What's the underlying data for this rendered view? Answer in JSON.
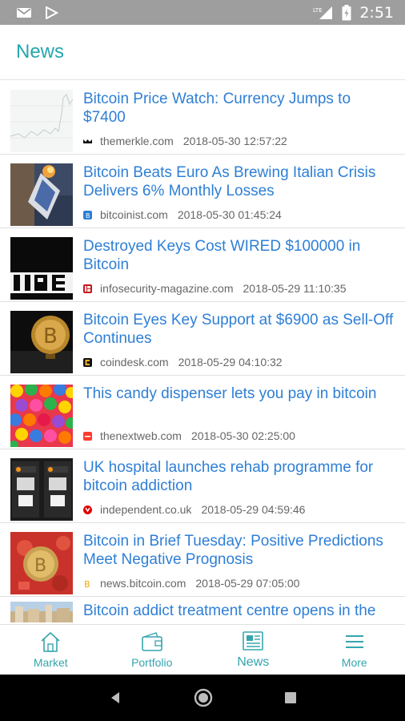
{
  "status_bar": {
    "time": "2:51",
    "network": "LTE",
    "icons": [
      "gmail-icon",
      "play-store-icon",
      "lte-signal-icon",
      "battery-icon"
    ]
  },
  "app_bar": {
    "title": "News"
  },
  "colors": {
    "accent": "#26a6b0",
    "headline": "#2e7fd6"
  },
  "news": [
    {
      "headline": "Bitcoin Price Watch: Currency Jumps to $7400",
      "source": "themerkle.com",
      "timestamp": "2018-05-30 12:57:22",
      "source_icon": "themerkle-icon",
      "thumbnail": "price-chart-thumbnail"
    },
    {
      "headline": "Bitcoin Beats Euro As Brewing Italian Crisis Delivers 6% Monthly Losses",
      "source": "bitcoinist.com",
      "timestamp": "2018-05-30 01:45:24",
      "source_icon": "bitcoinist-icon",
      "thumbnail": "burning-bitcoin-thumbnail"
    },
    {
      "headline": "Destroyed Keys Cost WIRED $100000 in Bitcoin",
      "source": "infosecurity-magazine.com",
      "timestamp": "2018-05-29 11:10:35",
      "source_icon": "infosecurity-icon",
      "thumbnail": "wired-logo-thumbnail"
    },
    {
      "headline": "Bitcoin Eyes Key Support at $6900 as Sell-Off Continues",
      "source": "coindesk.com",
      "timestamp": "2018-05-29 04:10:32",
      "source_icon": "coindesk-icon",
      "thumbnail": "gold-coin-thumbnail"
    },
    {
      "headline": "This candy dispenser lets you pay in bitcoin",
      "source": "thenextweb.com",
      "timestamp": "2018-05-30 02:25:00",
      "source_icon": "thenextweb-icon",
      "thumbnail": "candy-thumbnail"
    },
    {
      "headline": "UK hospital launches rehab programme for bitcoin addiction",
      "source": "independent.co.uk",
      "timestamp": "2018-05-29 04:59:46",
      "source_icon": "independent-icon",
      "thumbnail": "bitcoin-atm-thumbnail"
    },
    {
      "headline": "Bitcoin in Brief Tuesday: Positive Predictions Meet Negative Prognosis",
      "source": "news.bitcoin.com",
      "timestamp": "2018-05-29 07:05:00",
      "source_icon": "bitcoin-news-icon",
      "thumbnail": "red-coin-thumbnail"
    },
    {
      "headline": "Bitcoin addict treatment centre opens in the",
      "source": "",
      "timestamp": "",
      "source_icon": "",
      "thumbnail": "town-thumbnail"
    }
  ],
  "bottom_nav": [
    {
      "label": "Market",
      "icon": "home-icon"
    },
    {
      "label": "Portfolio",
      "icon": "wallet-icon"
    },
    {
      "label": "News",
      "icon": "newspaper-icon",
      "active": true
    },
    {
      "label": "More",
      "icon": "menu-icon"
    }
  ]
}
